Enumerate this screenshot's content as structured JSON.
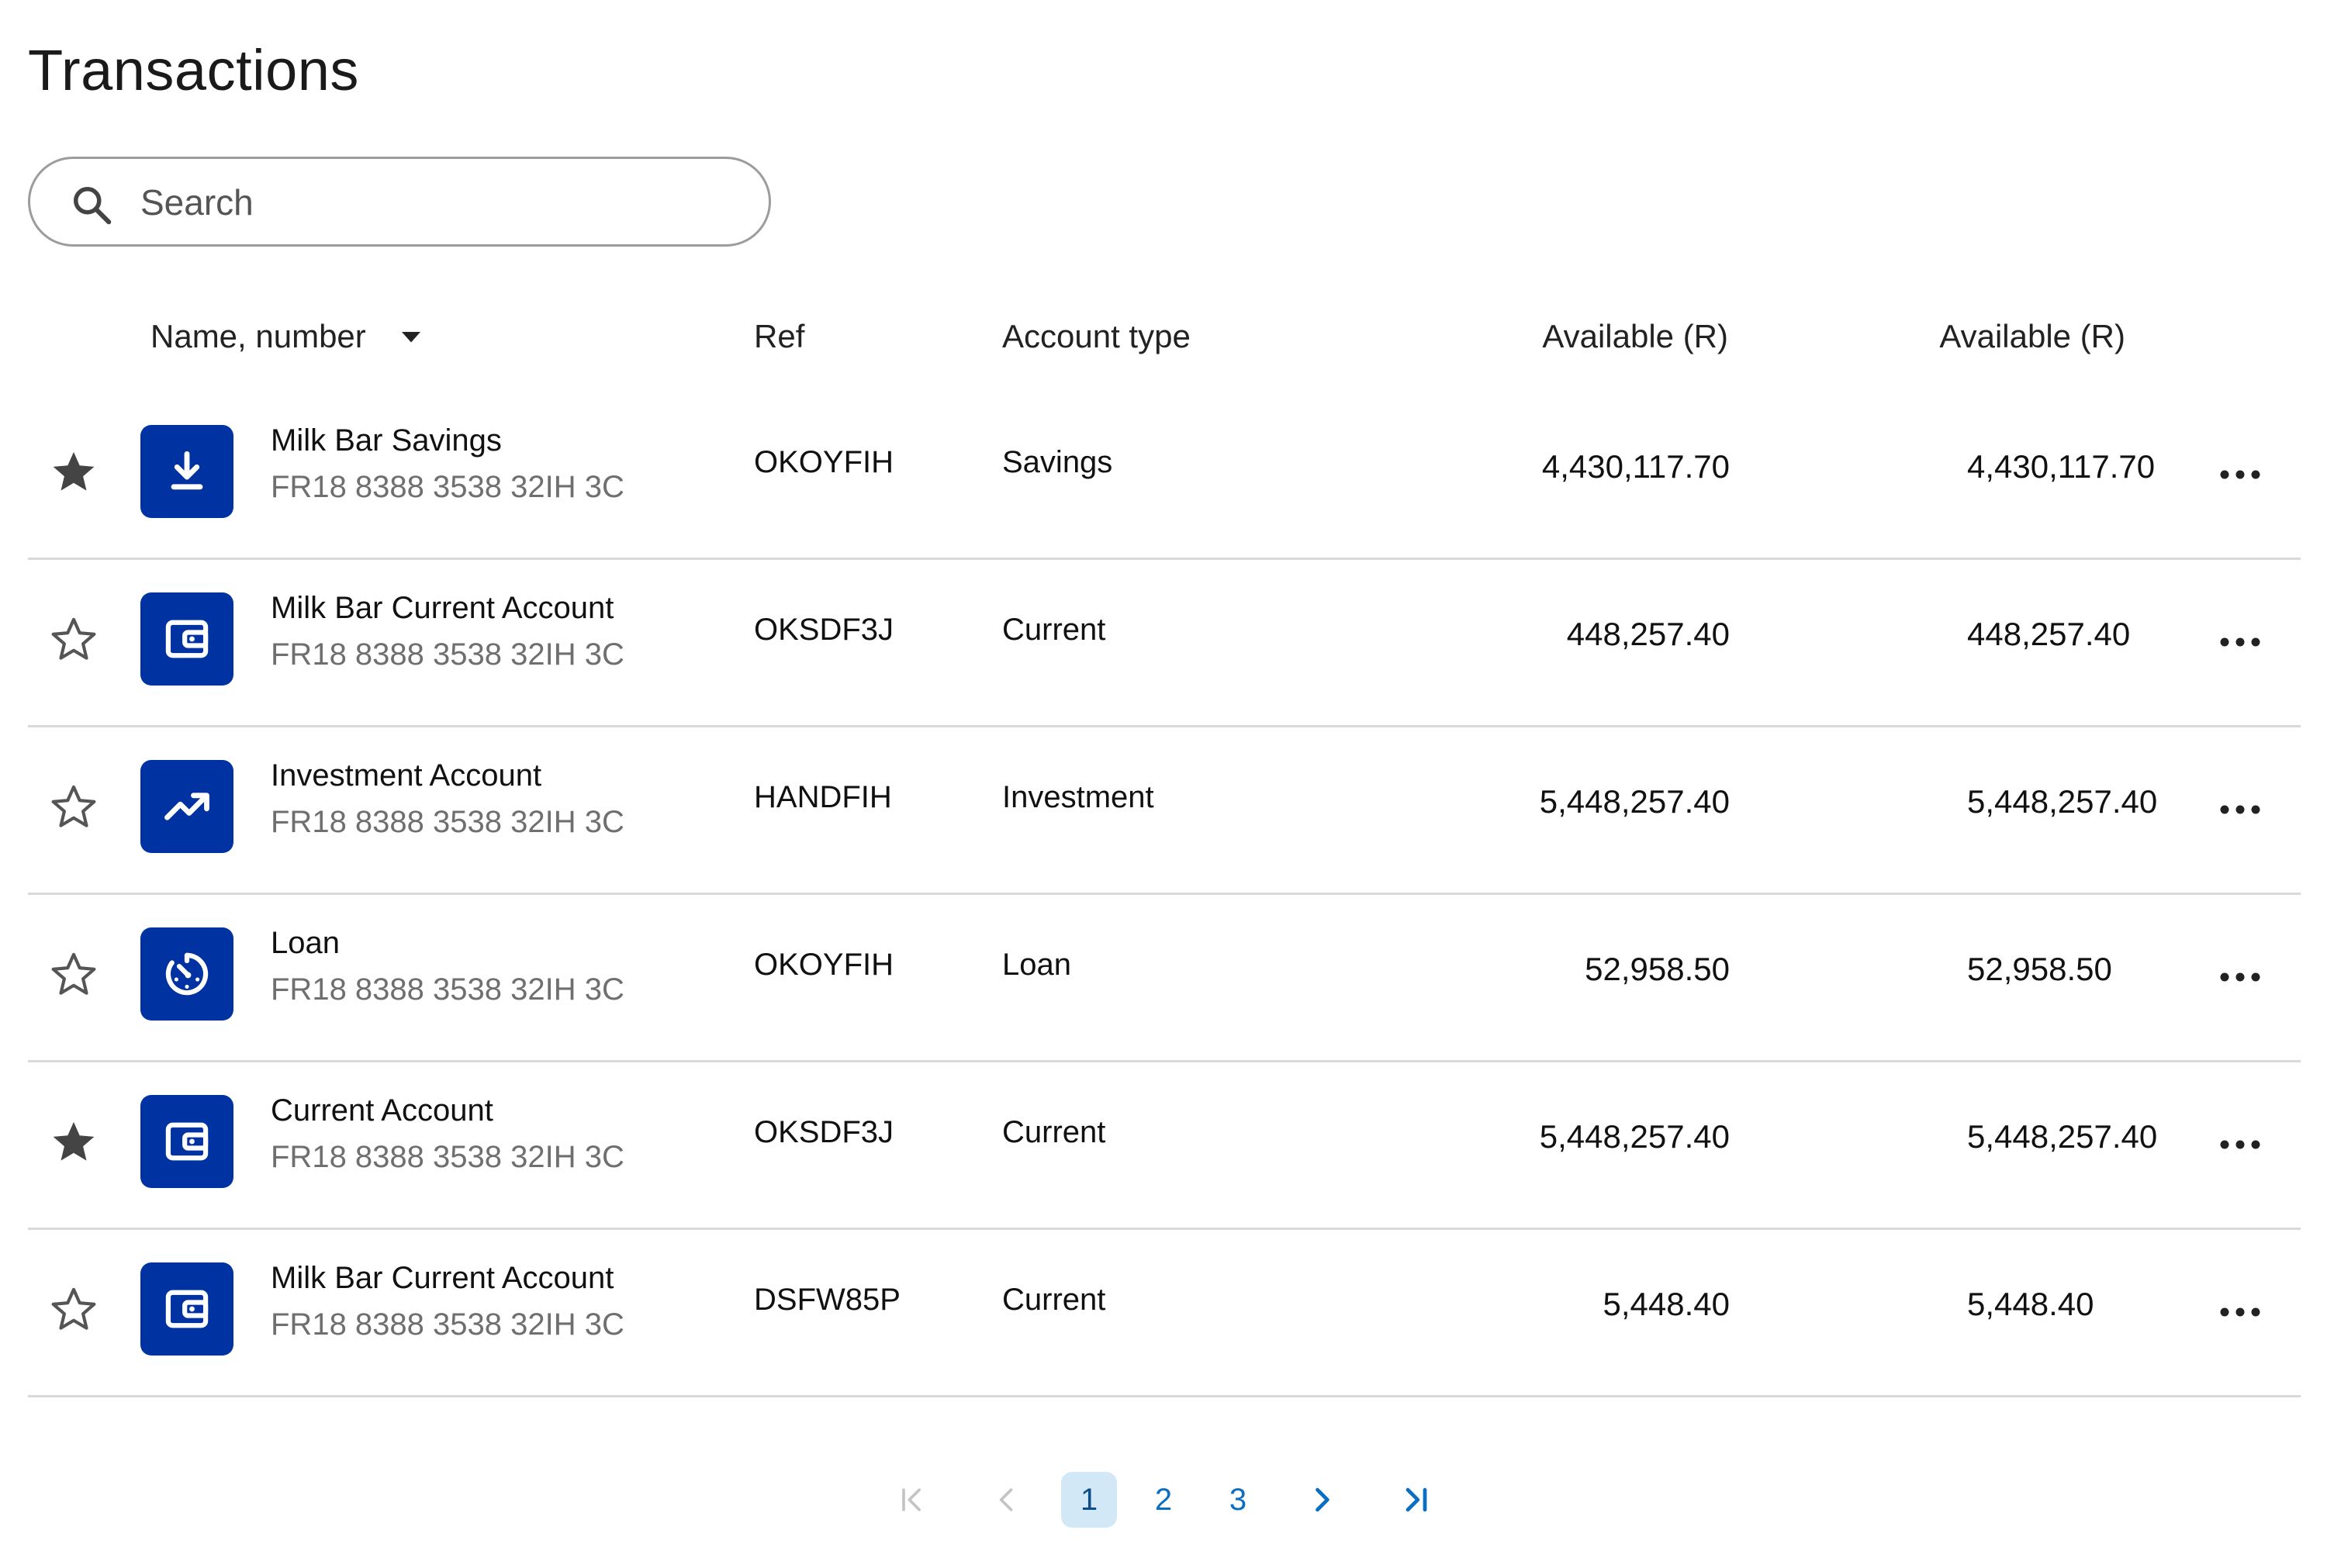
{
  "page": {
    "title": "Transactions"
  },
  "search": {
    "placeholder": "Search",
    "value": ""
  },
  "table": {
    "headers": {
      "name": "Name, number",
      "ref": "Ref",
      "account_type": "Account type",
      "available_1": "Available (R)",
      "available_2": "Available (R)"
    },
    "rows": [
      {
        "favorite": true,
        "icon": "savings-download-icon",
        "name": "Milk Bar Savings",
        "number": "FR18 8388 3538 32IH 3C",
        "ref": "OKOYFIH",
        "account_type": "Savings",
        "available_1": "4,430,117.70",
        "available_2": "4,430,117.70"
      },
      {
        "favorite": false,
        "icon": "wallet-icon",
        "name": "Milk Bar Current Account",
        "number": "FR18 8388 3538 32IH 3C",
        "ref": "OKSDF3J",
        "account_type": "Current",
        "available_1": "448,257.40",
        "available_2": "448,257.40"
      },
      {
        "favorite": false,
        "icon": "trending-up-icon",
        "name": "Investment Account",
        "number": "FR18 8388 3538 32IH 3C",
        "ref": "HANDFIH",
        "account_type": "Investment",
        "available_1": "5,448,257.40",
        "available_2": "5,448,257.40"
      },
      {
        "favorite": false,
        "icon": "loan-timer-icon",
        "name": "Loan",
        "number": "FR18 8388 3538 32IH 3C",
        "ref": "OKOYFIH",
        "account_type": "Loan",
        "available_1": "52,958.50",
        "available_2": "52,958.50"
      },
      {
        "favorite": true,
        "icon": "wallet-icon",
        "name": "Current Account",
        "number": "FR18 8388 3538 32IH 3C",
        "ref": "OKSDF3J",
        "account_type": "Current",
        "available_1": "5,448,257.40",
        "available_2": "5,448,257.40"
      },
      {
        "favorite": false,
        "icon": "wallet-icon",
        "name": "Milk Bar Current Account",
        "number": "FR18 8388 3538 32IH 3C",
        "ref": "DSFW85P",
        "account_type": "Current",
        "available_1": "5,448.40",
        "available_2": "5,448.40"
      }
    ]
  },
  "pagination": {
    "pages": [
      "1",
      "2",
      "3"
    ],
    "current": "1"
  },
  "colors": {
    "icon_bg": "#0033a1",
    "link": "#0a6fc2",
    "active_page_bg": "#d3e8f7",
    "divider": "#d9d9d9"
  }
}
